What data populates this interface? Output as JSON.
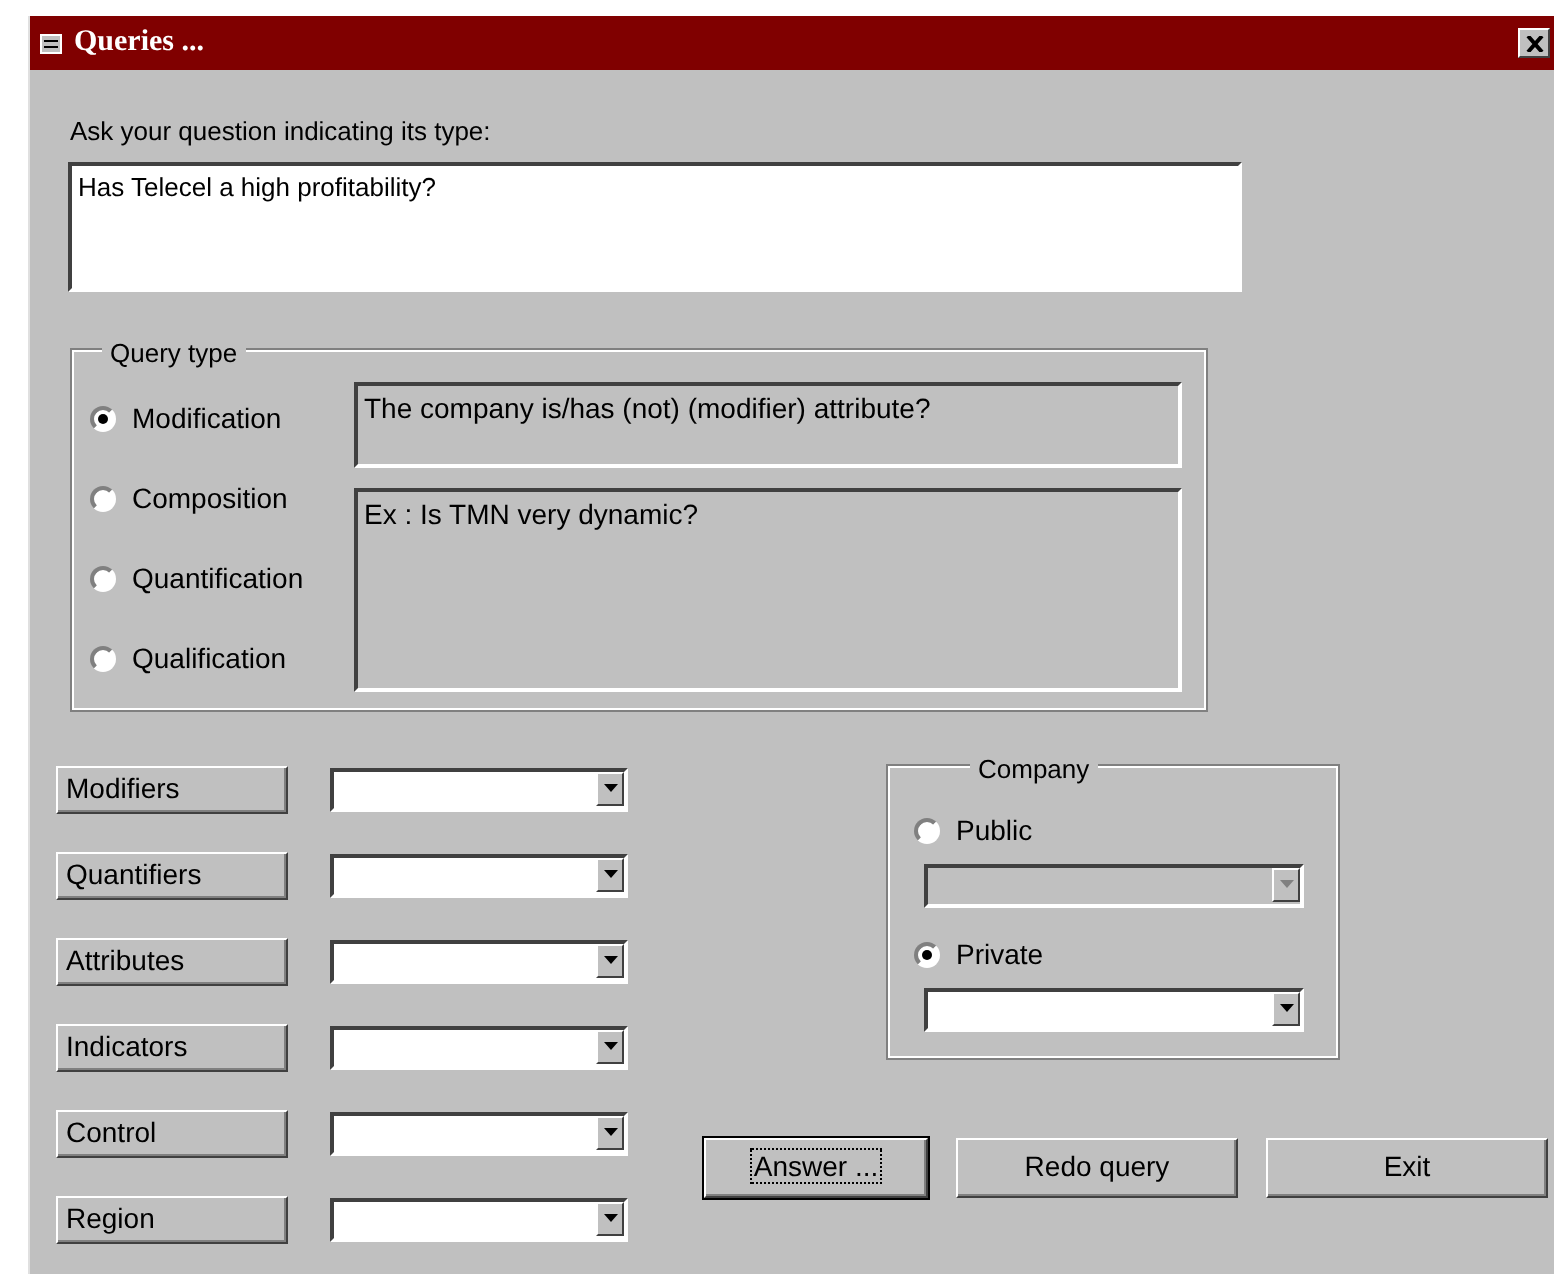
{
  "window": {
    "title": "Queries ..."
  },
  "question": {
    "label": "Ask your question indicating its type:",
    "value": "Has Telecel a high profitability?"
  },
  "query_type": {
    "legend": "Query type",
    "options": [
      {
        "label": "Modification",
        "selected": true
      },
      {
        "label": "Composition",
        "selected": false
      },
      {
        "label": "Quantification",
        "selected": false
      },
      {
        "label": "Qualification",
        "selected": false
      }
    ],
    "pattern": "The company is/has (not) (modifier) attribute?",
    "example": "Ex : Is TMN very dynamic?"
  },
  "selectors": [
    {
      "button": "Modifiers"
    },
    {
      "button": "Quantifiers"
    },
    {
      "button": "Attributes"
    },
    {
      "button": "Indicators"
    },
    {
      "button": "Control"
    },
    {
      "button": "Region"
    }
  ],
  "company": {
    "legend": "Company",
    "options": [
      {
        "label": "Public",
        "selected": false
      },
      {
        "label": "Private",
        "selected": true
      }
    ]
  },
  "actions": [
    {
      "label": "Answer ...",
      "focused": true
    },
    {
      "label": "Redo query",
      "focused": false
    },
    {
      "label": "Exit",
      "focused": false
    }
  ]
}
